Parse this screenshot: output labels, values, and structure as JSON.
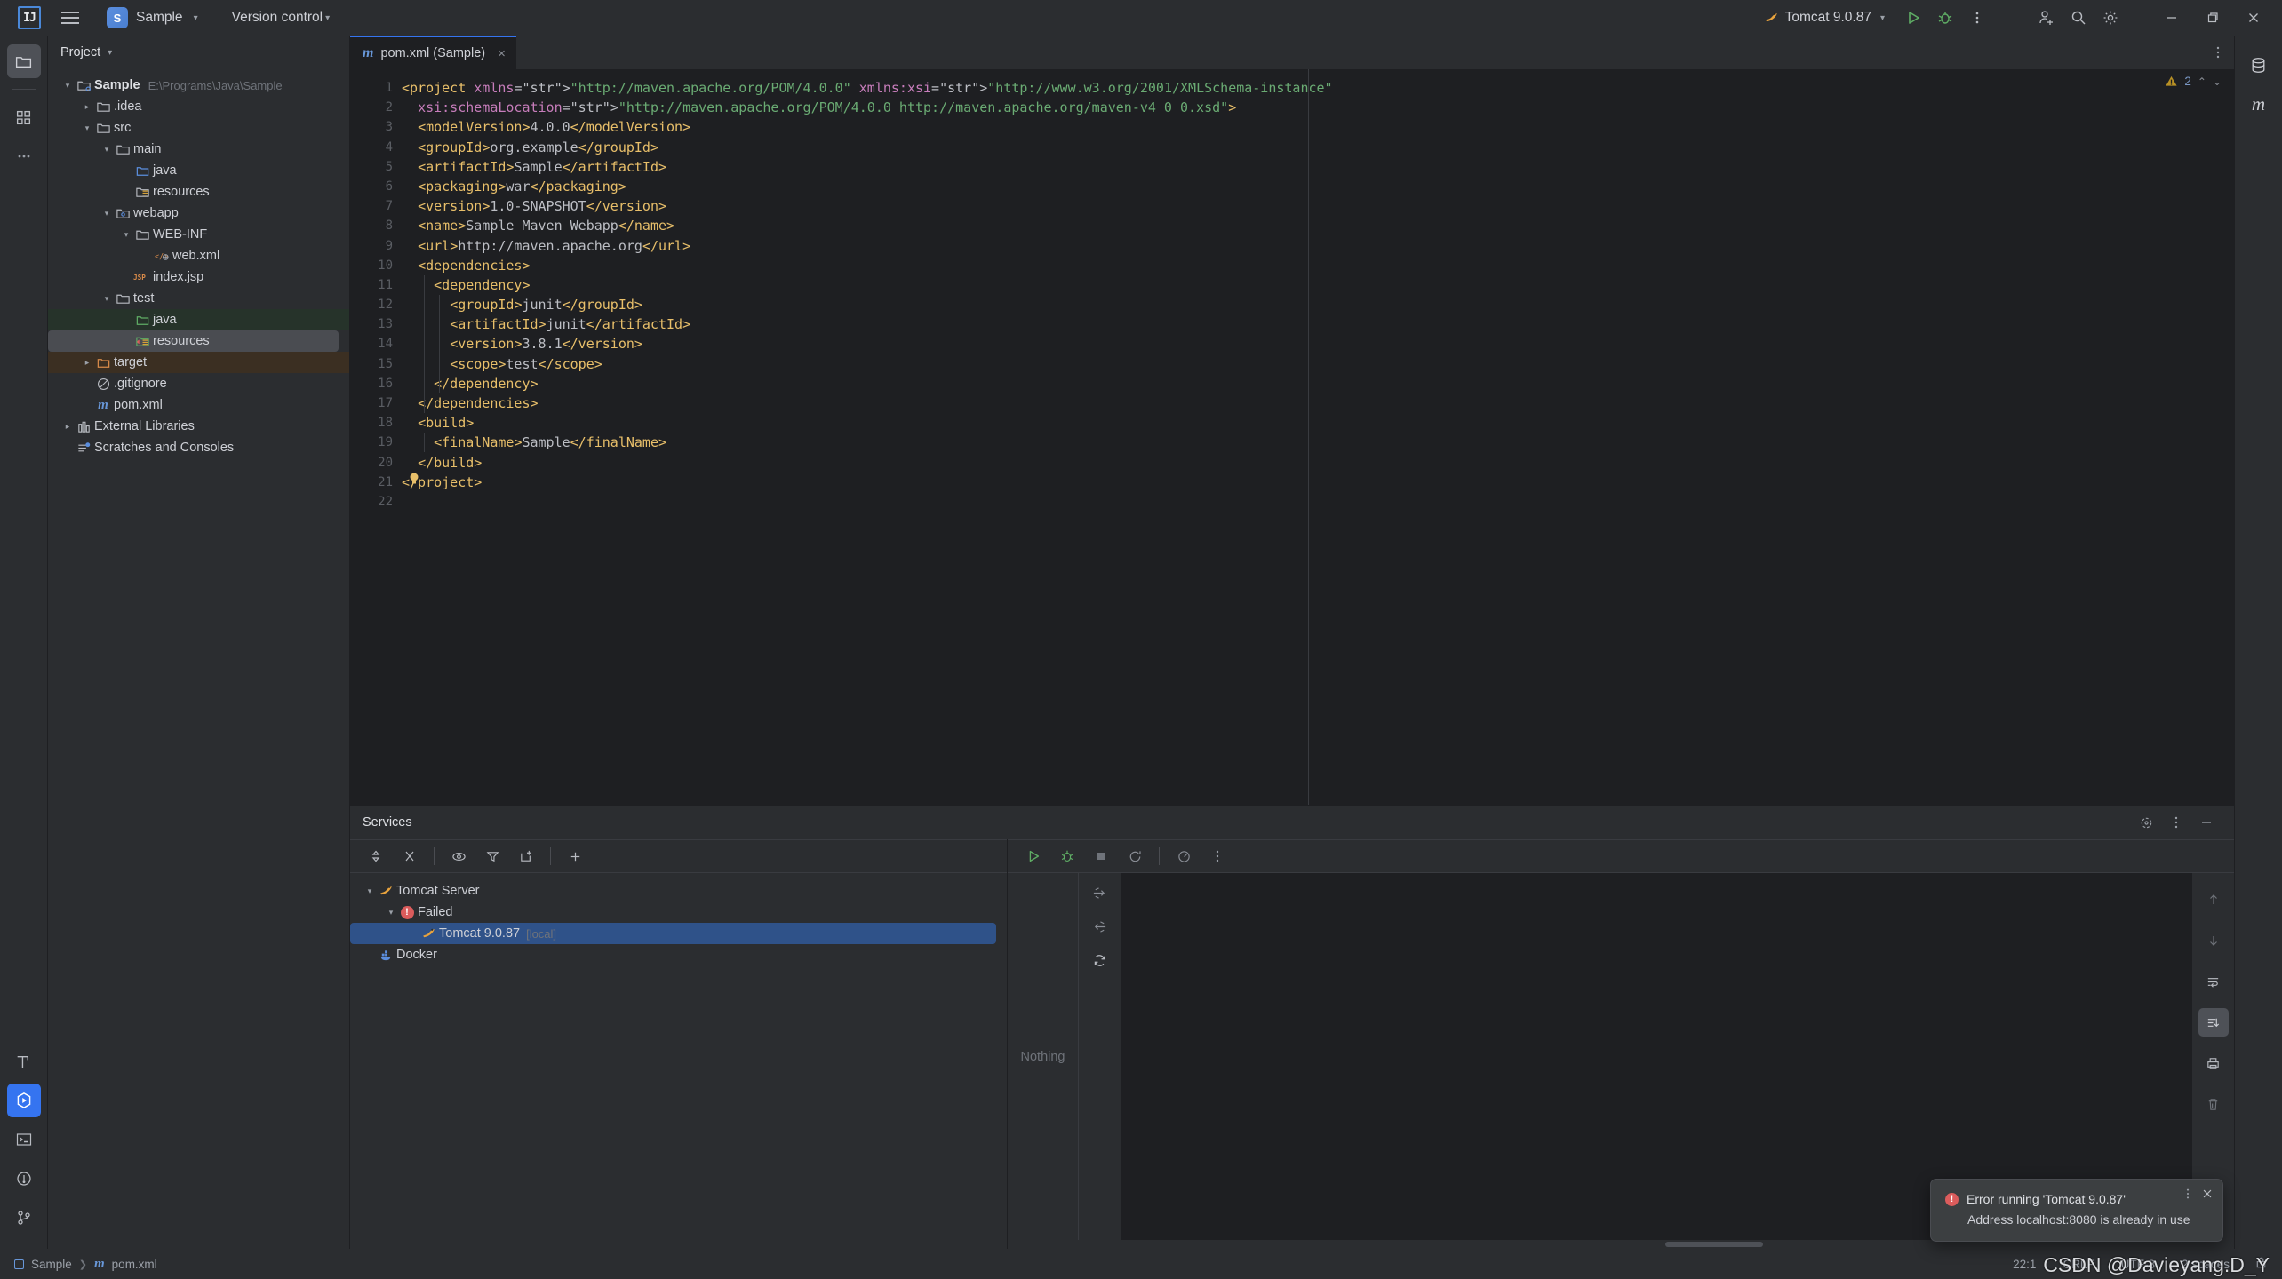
{
  "titlebar": {
    "logo": "IJ",
    "menu_icon": "hamburger-icon",
    "project_badge": "S",
    "project_name": "Sample",
    "vcs_label": "Version control",
    "run_config": "Tomcat 9.0.87",
    "icons": {
      "run": "run-icon",
      "debug": "debug-icon",
      "more": "more-vertical-icon",
      "account": "add-account-icon",
      "search": "search-icon",
      "settings": "gear-icon",
      "minimize": "minimize-icon",
      "maximize": "maximize-icon",
      "close": "close-icon"
    }
  },
  "rail": {
    "top": [
      {
        "name": "project-tool-window",
        "icon": "folder-icon",
        "active": true
      },
      {
        "name": "commit-tool-window",
        "icon": "structure-icon",
        "active": false
      },
      {
        "name": "more-tool-windows",
        "icon": "more-horizontal-icon",
        "active": false
      }
    ],
    "bottom": [
      {
        "name": "build-tool-window",
        "icon": "hammer-icon",
        "active": false
      },
      {
        "name": "services-tool-window",
        "icon": "services-icon",
        "active": true
      },
      {
        "name": "terminal-tool-window",
        "icon": "terminal-icon",
        "active": false
      },
      {
        "name": "problems-tool-window",
        "icon": "warning-circle-icon",
        "active": false
      },
      {
        "name": "git-tool-window",
        "icon": "git-branch-icon",
        "active": false
      }
    ]
  },
  "right_rail": [
    {
      "name": "database-tool-window",
      "icon": "database-icon"
    },
    {
      "name": "maven-tool-window",
      "icon": "maven-m-icon"
    }
  ],
  "project": {
    "header": "Project",
    "tree": [
      {
        "depth": 0,
        "arrow": "down",
        "icon": "module-icon",
        "label": "Sample",
        "sub": "E:\\Programs\\Java\\Sample",
        "bold": true,
        "bg": ""
      },
      {
        "depth": 1,
        "arrow": "right",
        "icon": "folder-icon",
        "label": ".idea",
        "sub": "",
        "bold": false,
        "bg": ""
      },
      {
        "depth": 1,
        "arrow": "down",
        "icon": "folder-icon",
        "label": "src",
        "sub": "",
        "bold": false,
        "bg": ""
      },
      {
        "depth": 2,
        "arrow": "down",
        "icon": "folder-icon",
        "label": "main",
        "sub": "",
        "bold": false,
        "bg": ""
      },
      {
        "depth": 3,
        "arrow": "none",
        "icon": "folder-source-icon",
        "label": "java",
        "sub": "",
        "bold": false,
        "bg": ""
      },
      {
        "depth": 3,
        "arrow": "none",
        "icon": "folder-resource-icon",
        "label": "resources",
        "sub": "",
        "bold": false,
        "bg": ""
      },
      {
        "depth": 2,
        "arrow": "down",
        "icon": "folder-webapp-icon",
        "label": "webapp",
        "sub": "",
        "bold": false,
        "bg": ""
      },
      {
        "depth": 3,
        "arrow": "down",
        "icon": "folder-icon",
        "label": "WEB-INF",
        "sub": "",
        "bold": false,
        "bg": ""
      },
      {
        "depth": 4,
        "arrow": "none",
        "icon": "xml-file-icon",
        "label": "web.xml",
        "sub": "",
        "bold": false,
        "bg": ""
      },
      {
        "depth": 3,
        "arrow": "none",
        "icon": "jsp-file-icon",
        "label": "index.jsp",
        "sub": "",
        "bold": false,
        "bg": ""
      },
      {
        "depth": 2,
        "arrow": "down",
        "icon": "folder-icon",
        "label": "test",
        "sub": "",
        "bold": false,
        "bg": ""
      },
      {
        "depth": 3,
        "arrow": "none",
        "icon": "folder-test-source-icon",
        "label": "java",
        "sub": "",
        "bold": false,
        "bg": "green"
      },
      {
        "depth": 3,
        "arrow": "none",
        "icon": "folder-test-resource-icon",
        "label": "resources",
        "sub": "",
        "bold": false,
        "bg": "selected"
      },
      {
        "depth": 1,
        "arrow": "right",
        "icon": "folder-excluded-icon",
        "label": "target",
        "sub": "",
        "bold": false,
        "bg": "brown"
      },
      {
        "depth": 1,
        "arrow": "none",
        "icon": "gitignore-icon",
        "label": ".gitignore",
        "sub": "",
        "bold": false,
        "bg": ""
      },
      {
        "depth": 1,
        "arrow": "none",
        "icon": "maven-m-icon",
        "label": "pom.xml",
        "sub": "",
        "bold": false,
        "bg": ""
      },
      {
        "depth": 0,
        "arrow": "right",
        "icon": "libraries-icon",
        "label": "External Libraries",
        "sub": "",
        "bold": false,
        "bg": ""
      },
      {
        "depth": 0,
        "arrow": "none",
        "icon": "scratches-icon",
        "label": "Scratches and Consoles",
        "sub": "",
        "bold": false,
        "bg": ""
      }
    ]
  },
  "editor": {
    "tab": {
      "icon": "maven-m-icon",
      "label": "pom.xml (Sample)",
      "close": "×"
    },
    "inspection": {
      "warn_icon": "warning-triangle-icon",
      "count": "2",
      "prev": "⌃",
      "next": "⌄"
    },
    "gutter_lines": [
      "1",
      "2",
      "3",
      "4",
      "5",
      "6",
      "7",
      "8",
      "9",
      "10",
      "11",
      "12",
      "13",
      "14",
      "15",
      "16",
      "17",
      "18",
      "19",
      "20",
      "21",
      "22"
    ],
    "code_lines": [
      "<project xmlns=\"http://maven.apache.org/POM/4.0.0\" xmlns:xsi=\"http://www.w3.org/2001/XMLSchema-instance\"",
      "  xsi:schemaLocation=\"http://maven.apache.org/POM/4.0.0 http://maven.apache.org/maven-v4_0_0.xsd\">",
      "  <modelVersion>4.0.0</modelVersion>",
      "  <groupId>org.example</groupId>",
      "  <artifactId>Sample</artifactId>",
      "  <packaging>war</packaging>",
      "  <version>1.0-SNAPSHOT</version>",
      "  <name>Sample Maven Webapp</name>",
      "  <url>http://maven.apache.org</url>",
      "  <dependencies>",
      "    <dependency>",
      "      <groupId>junit</groupId>",
      "      <artifactId>junit</artifactId>",
      "      <version>3.8.1</version>",
      "      <scope>test</scope>",
      "    </dependency>",
      "  </dependencies>",
      "  <build>",
      "    <finalName>Sample</finalName>",
      "  </build>",
      "</project>",
      ""
    ]
  },
  "services": {
    "header": "Services",
    "header_icons": [
      "target-icon",
      "more-vertical-icon",
      "minimize-icon"
    ],
    "toolbar": [
      "expand-collapse-icon",
      "close-all-icon",
      "show-icon",
      "filter-icon",
      "new-tab-icon",
      "add-icon"
    ],
    "run_toolbar": [
      "run-icon",
      "debug-icon",
      "stop-icon",
      "rerun-icon",
      "profile-icon",
      "more-vertical-icon"
    ],
    "tree": [
      {
        "depth": 0,
        "arrow": "down",
        "icon": "tomcat-icon",
        "label": "Tomcat Server",
        "sub": "",
        "selected": false
      },
      {
        "depth": 1,
        "arrow": "down",
        "icon": "error-icon",
        "label": "Failed",
        "sub": "",
        "selected": false
      },
      {
        "depth": 2,
        "arrow": "none",
        "icon": "tomcat-icon",
        "label": "Tomcat 9.0.87",
        "sub": "[local]",
        "selected": true
      },
      {
        "depth": 0,
        "arrow": "none",
        "icon": "docker-icon",
        "label": "Docker",
        "sub": "",
        "selected": false
      }
    ],
    "nothing_label": "Nothing",
    "mini_gutter_icons": [
      "expand-right-icon",
      "collapse-left-icon",
      "refresh-icon"
    ],
    "console_gutter_icons": [
      "arrow-up-icon",
      "arrow-down-icon",
      "soft-wrap-icon",
      "scroll-to-end-icon",
      "print-icon",
      "trash-icon"
    ]
  },
  "notification": {
    "icon": "error-icon",
    "title": "Error running 'Tomcat 9.0.87'",
    "message": "Address localhost:8080 is already in use",
    "more": "more-vertical-icon",
    "close": "×"
  },
  "status": {
    "breadcrumb": [
      {
        "icon": "module-icon",
        "label": "Sample"
      },
      {
        "icon": "maven-m-icon",
        "label": "pom.xml"
      }
    ],
    "caret": "22:1",
    "line_sep": "CRLF",
    "encoding": "UTF-8",
    "indent": "2 spaces",
    "lock_icon": "lock-icon"
  },
  "watermark": "CSDN @Davieyang.D_Y",
  "colors": {
    "accent": "#3574f0",
    "selection": "#2f5289",
    "error": "#db5c5c",
    "warning": "#b89025",
    "green_source": "#26332a",
    "brown_excluded": "#3b2f22",
    "bg": "#1e1f22",
    "panel": "#2b2d30"
  }
}
